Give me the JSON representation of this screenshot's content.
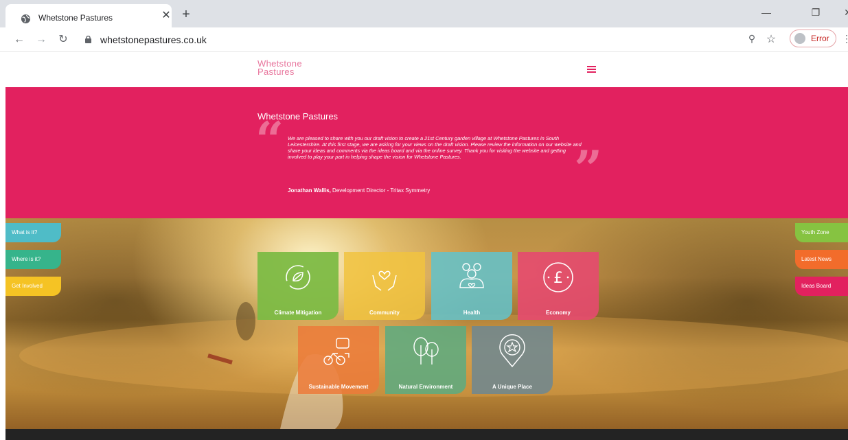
{
  "browser": {
    "tab_title": "Whetstone Pastures",
    "url": "whetstonepastures.co.uk",
    "profile_label": "Error"
  },
  "site": {
    "logo_line1": "Whetstone",
    "logo_line2": "Pastures"
  },
  "hero": {
    "title": "Whetstone Pastures",
    "quote": "We are pleased to share with you our draft vision to create a 21st Century garden village at Whetstone Pastures in South Leicestershire. At this first stage, we are asking for your views on the draft vision. Please review the information on our website and share your ideas and comments via the ideas board and via the online survey. Thank you for visiting the website and getting involved to play your part in helping shape the vision for Whetstone Pastures.",
    "attribution_name": "Jonathan Wallis,",
    "attribution_role": " Development Director - Tritax Symmetry"
  },
  "left_tabs": [
    {
      "label": "What is it?",
      "color": "#4fbcc7"
    },
    {
      "label": "Where is it?",
      "color": "#36b48b"
    },
    {
      "label": "Get Involved",
      "color": "#f5c324"
    }
  ],
  "right_tabs": [
    {
      "label": "Youth Zone",
      "color": "#86c341"
    },
    {
      "label": "Latest News",
      "color": "#f26c2b"
    },
    {
      "label": "Ideas Board",
      "color": "#e2215f"
    }
  ],
  "tiles": [
    {
      "label": "Climate Mitigation",
      "icon": "recycle-leaf-icon",
      "color": "#7dbb45"
    },
    {
      "label": "Community",
      "icon": "hands-heart-icon",
      "color": "#f1c33f"
    },
    {
      "label": "Health",
      "icon": "people-heart-icon",
      "color": "#64c2c8"
    },
    {
      "label": "Economy",
      "icon": "pound-icon",
      "color": "#e64a6f"
    },
    {
      "label": "Sustainable Movement",
      "icon": "car-bike-icon",
      "color": "#ec7a3a"
    },
    {
      "label": "Natural Environment",
      "icon": "trees-icon",
      "color": "#5fab80"
    },
    {
      "label": "A Unique Place",
      "icon": "star-pin-icon",
      "color": "#6f8790"
    }
  ]
}
